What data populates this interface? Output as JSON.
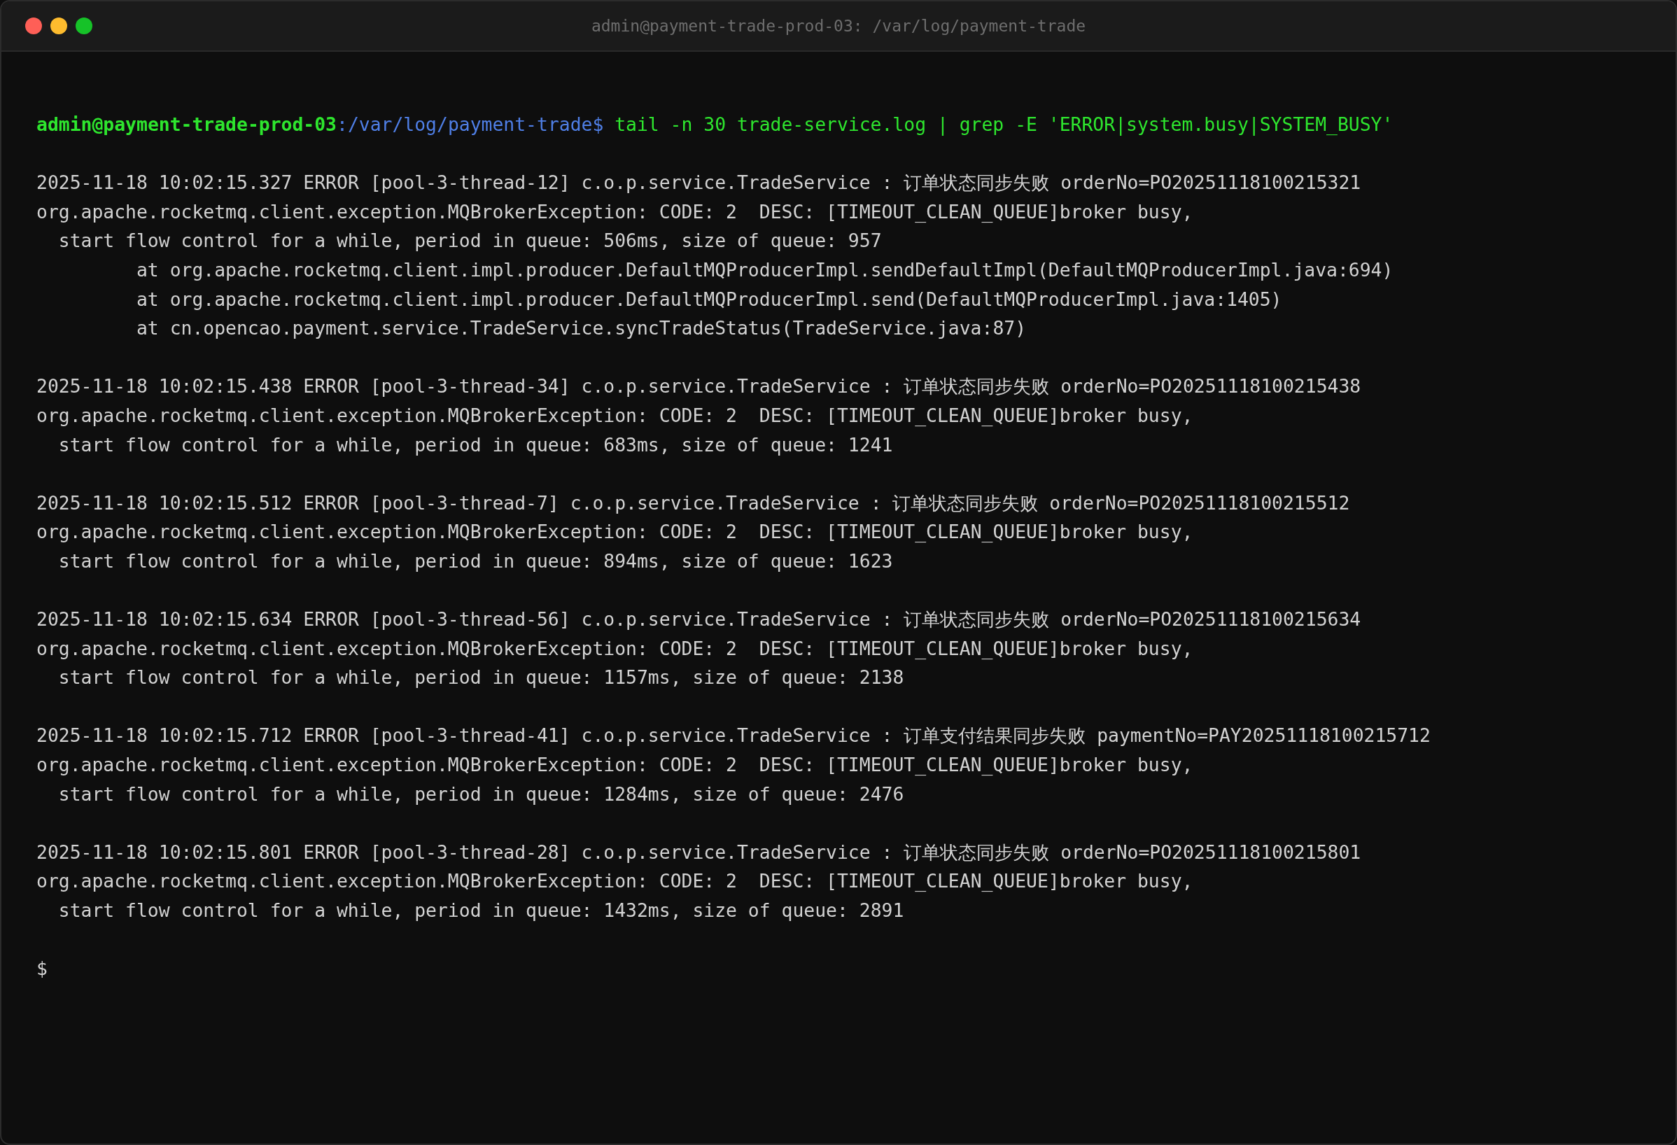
{
  "window": {
    "title": "admin@payment-trade-prod-03: /var/log/payment-trade"
  },
  "prompt": {
    "user_host": "admin@payment-trade-prod-03",
    "path": ":/var/log/payment-trade$",
    "command": "tail -n 30 trade-service.log | grep -E 'ERROR|system.busy|SYSTEM_BUSY'"
  },
  "blocks": [
    {
      "lines": [
        {
          "kind": "header",
          "text": "2025-11-18 10:02:15.327 ERROR [pool-3-thread-12] c.o.p.service.TradeService : 订单状态同步失败 orderNo=PO20251118100215321"
        },
        {
          "kind": "exception",
          "text": "org.apache.rocketmq.client.exception.MQBrokerException: CODE: 2  DESC: [TIMEOUT_CLEAN_QUEUE]broker busy,"
        },
        {
          "kind": "detail",
          "text": "start flow control for a while, period in queue: 506ms, size of queue: 957"
        },
        {
          "kind": "frame",
          "text": "at org.apache.rocketmq.client.impl.producer.DefaultMQProducerImpl.sendDefaultImpl(DefaultMQProducerImpl.java:694)"
        },
        {
          "kind": "frame",
          "text": "at org.apache.rocketmq.client.impl.producer.DefaultMQProducerImpl.send(DefaultMQProducerImpl.java:1405)"
        },
        {
          "kind": "frame",
          "text": "at cn.opencao.payment.service.TradeService.syncTradeStatus(TradeService.java:87)"
        }
      ]
    },
    {
      "lines": [
        {
          "kind": "header",
          "text": "2025-11-18 10:02:15.438 ERROR [pool-3-thread-34] c.o.p.service.TradeService : 订单状态同步失败 orderNo=PO20251118100215438"
        },
        {
          "kind": "exception",
          "text": "org.apache.rocketmq.client.exception.MQBrokerException: CODE: 2  DESC: [TIMEOUT_CLEAN_QUEUE]broker busy,"
        },
        {
          "kind": "detail",
          "text": "start flow control for a while, period in queue: 683ms, size of queue: 1241"
        }
      ]
    },
    {
      "lines": [
        {
          "kind": "header",
          "text": "2025-11-18 10:02:15.512 ERROR [pool-3-thread-7] c.o.p.service.TradeService : 订单状态同步失败 orderNo=PO20251118100215512"
        },
        {
          "kind": "exception",
          "text": "org.apache.rocketmq.client.exception.MQBrokerException: CODE: 2  DESC: [TIMEOUT_CLEAN_QUEUE]broker busy,"
        },
        {
          "kind": "detail",
          "text": "start flow control for a while, period in queue: 894ms, size of queue: 1623"
        }
      ]
    },
    {
      "lines": [
        {
          "kind": "header",
          "text": "2025-11-18 10:02:15.634 ERROR [pool-3-thread-56] c.o.p.service.TradeService : 订单状态同步失败 orderNo=PO20251118100215634"
        },
        {
          "kind": "exception",
          "text": "org.apache.rocketmq.client.exception.MQBrokerException: CODE: 2  DESC: [TIMEOUT_CLEAN_QUEUE]broker busy,"
        },
        {
          "kind": "detail",
          "text": "start flow control for a while, period in queue: 1157ms, size of queue: 2138"
        }
      ]
    },
    {
      "lines": [
        {
          "kind": "header",
          "text": "2025-11-18 10:02:15.712 ERROR [pool-3-thread-41] c.o.p.service.TradeService : 订单支付结果同步失败 paymentNo=PAY20251118100215712"
        },
        {
          "kind": "exception",
          "text": "org.apache.rocketmq.client.exception.MQBrokerException: CODE: 2  DESC: [TIMEOUT_CLEAN_QUEUE]broker busy,"
        },
        {
          "kind": "detail",
          "text": "start flow control for a while, period in queue: 1284ms, size of queue: 2476"
        }
      ]
    },
    {
      "lines": [
        {
          "kind": "header",
          "text": "2025-11-18 10:02:15.801 ERROR [pool-3-thread-28] c.o.p.service.TradeService : 订单状态同步失败 orderNo=PO20251118100215801"
        },
        {
          "kind": "exception",
          "text": "org.apache.rocketmq.client.exception.MQBrokerException: CODE: 2  DESC: [TIMEOUT_CLEAN_QUEUE]broker busy,"
        },
        {
          "kind": "detail",
          "text": "start flow control for a while, period in queue: 1432ms, size of queue: 2891"
        }
      ]
    }
  ],
  "final_prompt": "$"
}
